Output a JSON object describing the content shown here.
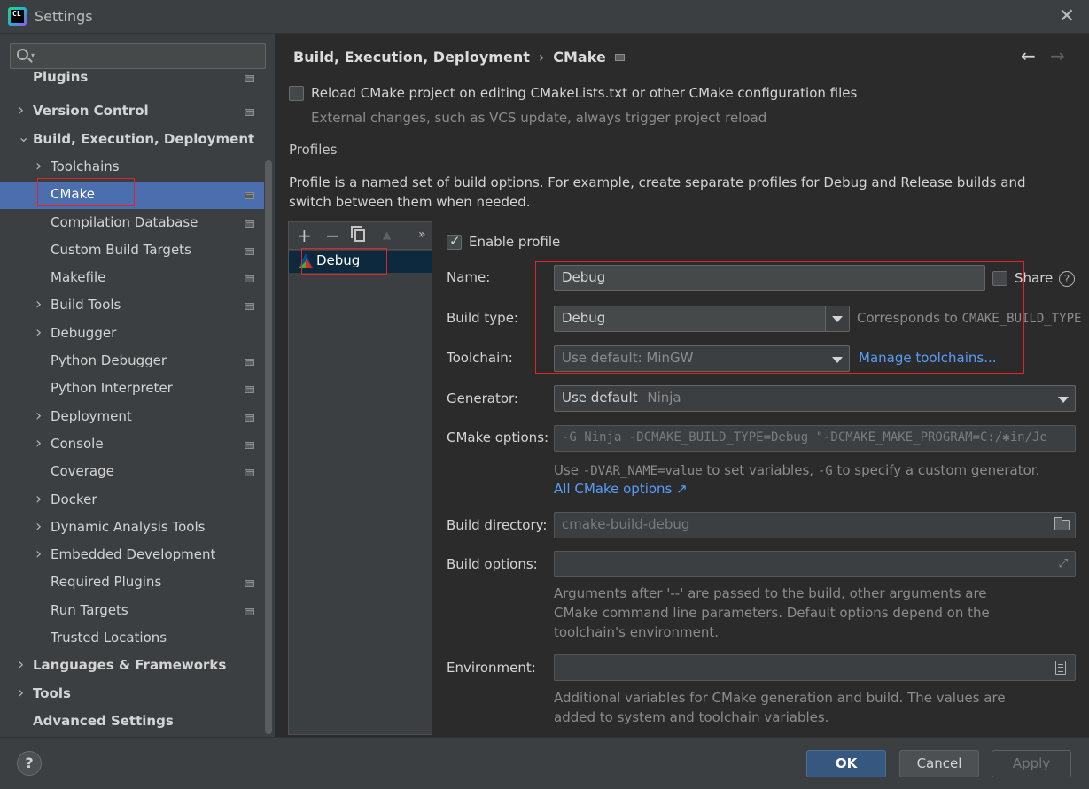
{
  "window": {
    "title": "Settings"
  },
  "search": {
    "placeholder": ""
  },
  "sidebar": {
    "items": [
      {
        "label": "Plugins",
        "bold": true,
        "chevron": false,
        "indent": 0,
        "project": true
      },
      {
        "label": "Version Control",
        "bold": true,
        "chevron": "right",
        "indent": 0,
        "project": true
      },
      {
        "label": "Build, Execution, Deployment",
        "bold": true,
        "chevron": "down",
        "indent": 0,
        "project": false
      },
      {
        "label": "Toolchains",
        "bold": false,
        "chevron": "right",
        "indent": 1,
        "project": false
      },
      {
        "label": "CMake",
        "bold": false,
        "chevron": false,
        "indent": 1,
        "project": true,
        "selected": true
      },
      {
        "label": "Compilation Database",
        "bold": false,
        "chevron": false,
        "indent": 1,
        "project": true
      },
      {
        "label": "Custom Build Targets",
        "bold": false,
        "chevron": false,
        "indent": 1,
        "project": true
      },
      {
        "label": "Makefile",
        "bold": false,
        "chevron": false,
        "indent": 1,
        "project": true
      },
      {
        "label": "Build Tools",
        "bold": false,
        "chevron": "right",
        "indent": 1,
        "project": true
      },
      {
        "label": "Debugger",
        "bold": false,
        "chevron": "right",
        "indent": 1,
        "project": false
      },
      {
        "label": "Python Debugger",
        "bold": false,
        "chevron": false,
        "indent": 1,
        "project": true
      },
      {
        "label": "Python Interpreter",
        "bold": false,
        "chevron": false,
        "indent": 1,
        "project": true
      },
      {
        "label": "Deployment",
        "bold": false,
        "chevron": "right",
        "indent": 1,
        "project": true
      },
      {
        "label": "Console",
        "bold": false,
        "chevron": "right",
        "indent": 1,
        "project": true
      },
      {
        "label": "Coverage",
        "bold": false,
        "chevron": false,
        "indent": 1,
        "project": true
      },
      {
        "label": "Docker",
        "bold": false,
        "chevron": "right",
        "indent": 1,
        "project": false
      },
      {
        "label": "Dynamic Analysis Tools",
        "bold": false,
        "chevron": "right",
        "indent": 1,
        "project": false
      },
      {
        "label": "Embedded Development",
        "bold": false,
        "chevron": "right",
        "indent": 1,
        "project": false
      },
      {
        "label": "Required Plugins",
        "bold": false,
        "chevron": false,
        "indent": 1,
        "project": true
      },
      {
        "label": "Run Targets",
        "bold": false,
        "chevron": false,
        "indent": 1,
        "project": true
      },
      {
        "label": "Trusted Locations",
        "bold": false,
        "chevron": false,
        "indent": 1,
        "project": false
      },
      {
        "label": "Languages & Frameworks",
        "bold": true,
        "chevron": "right",
        "indent": 0,
        "project": false
      },
      {
        "label": "Tools",
        "bold": true,
        "chevron": "right",
        "indent": 0,
        "project": false
      },
      {
        "label": "Advanced Settings",
        "bold": true,
        "chevron": false,
        "indent": 0,
        "project": false
      }
    ]
  },
  "breadcrumb": {
    "parent": "Build, Execution, Deployment",
    "separator": "›",
    "current": "CMake"
  },
  "reload": {
    "label": "Reload CMake project on editing CMakeLists.txt or other CMake configuration files",
    "hint": "External changes, such as VCS update, always trigger project reload",
    "checked": false
  },
  "profiles": {
    "section_title": "Profiles",
    "description": "Profile is a named set of build options. For example, create separate profiles for Debug and Release builds and switch between them when needed.",
    "list": [
      {
        "label": "Debug"
      }
    ],
    "toolbar": {
      "add": "+",
      "remove": "−",
      "up": "▲",
      "more": "»"
    }
  },
  "form": {
    "enable_profile_label": "Enable profile",
    "enable_profile_checked": true,
    "name_label": "Name:",
    "name_value": "Debug",
    "share_label": "Share",
    "share_checked": false,
    "help_glyph": "?",
    "build_type_label": "Build type:",
    "build_type_value": "Debug",
    "build_type_hint_prefix": "Corresponds to ",
    "build_type_hint_code": "CMAKE_BUILD_TYPE",
    "toolchain_label": "Toolchain:",
    "toolchain_value": "Use default: MinGW",
    "manage_toolchains_link": "Manage toolchains...",
    "generator_label": "Generator:",
    "generator_value": "Use default",
    "generator_default": "Ninja",
    "cmake_options_label": "CMake options:",
    "cmake_options_value": "-G Ninja -DCMAKE_BUILD_TYPE=Debug \"-DCMAKE_MAKE_PROGRAM=C:/✱in/Je",
    "cmake_hint_1": "Use ",
    "cmake_hint_code1": "-DVAR_NAME=value",
    "cmake_hint_2": " to set variables, ",
    "cmake_hint_code2": "-G",
    "cmake_hint_3": " to specify a custom generator.",
    "all_cmake_options_link": "All CMake options ↗",
    "build_directory_label": "Build directory:",
    "build_directory_value": "cmake-build-debug",
    "build_options_label": "Build options:",
    "build_options_value": "",
    "build_options_hint": "Arguments after '--' are passed to the build, other arguments are CMake command line parameters. Default options depend on the toolchain's environment.",
    "environment_label": "Environment:",
    "environment_value": "",
    "environment_hint": "Additional variables for CMake generation and build. The values are added to system and toolchain variables."
  },
  "buttons": {
    "help": "?",
    "ok": "OK",
    "cancel": "Cancel",
    "apply": "Apply"
  },
  "colors": {
    "selection": "#4b6eaf",
    "link": "#589df6",
    "primary_button": "#365880",
    "annotation_box": "#e0242a"
  }
}
